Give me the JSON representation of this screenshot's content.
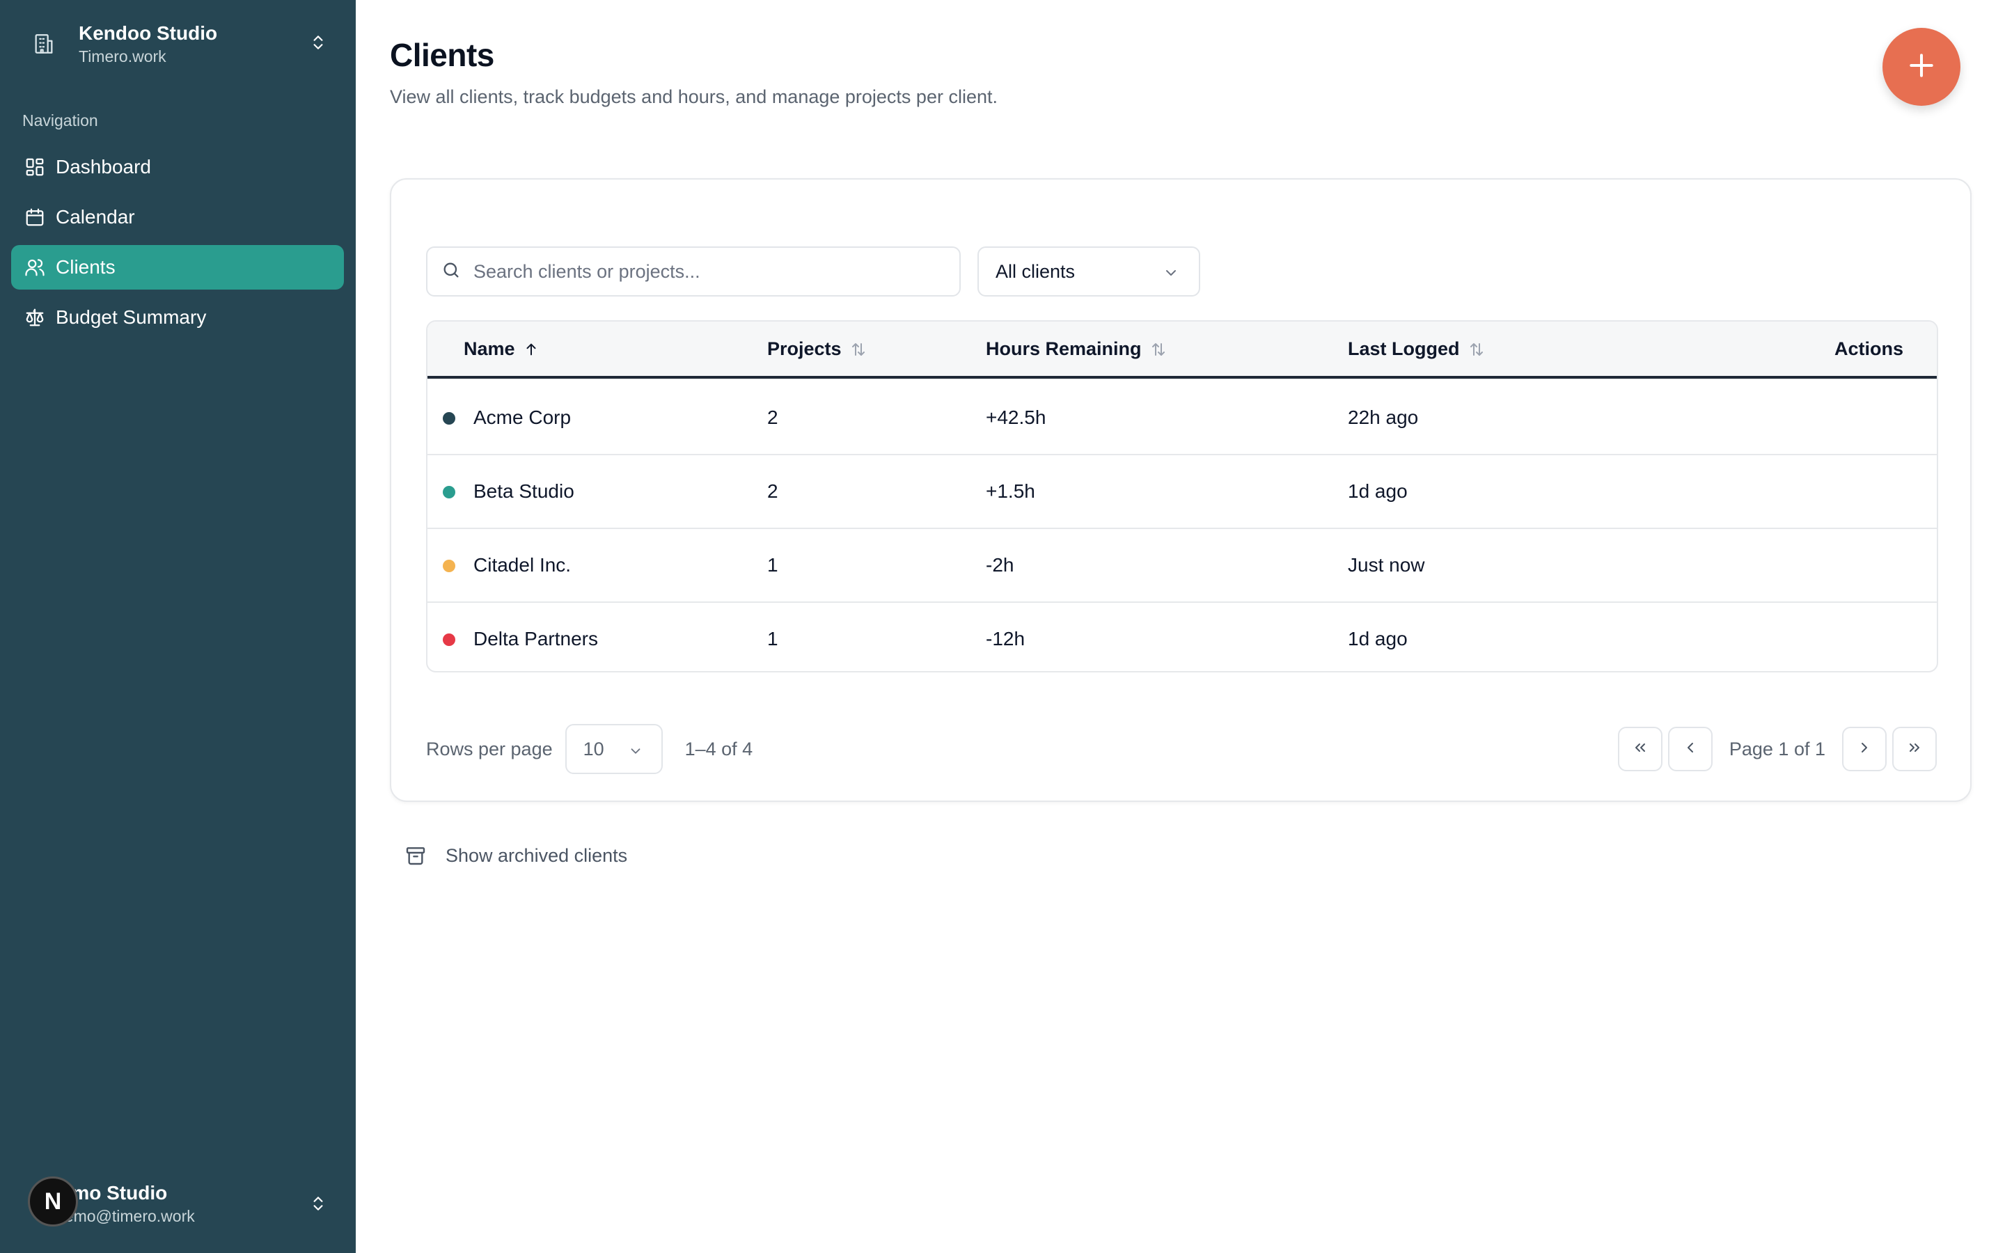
{
  "sidebar": {
    "team": {
      "name": "Kendoo Studio",
      "domain": "Timero.work",
      "icon": "building-icon"
    },
    "nav_label": "Navigation",
    "items": [
      {
        "label": "Dashboard",
        "icon": "layout-grid-icon",
        "active": false
      },
      {
        "label": "Calendar",
        "icon": "calendar-icon",
        "active": false
      },
      {
        "label": "Clients",
        "icon": "users-icon",
        "active": true
      },
      {
        "label": "Budget Summary",
        "icon": "scale-icon",
        "active": false
      }
    ],
    "user": {
      "avatar_letter": "N",
      "name": "Demo Studio",
      "name_visible": "mo Studio",
      "email": "demo@timero.work",
      "email_visible": "emo@timero.work"
    }
  },
  "header": {
    "title": "Clients",
    "description": "View all clients, track budgets and hours, and manage projects per client."
  },
  "toolbar": {
    "search_placeholder": "Search clients or projects...",
    "filter_value": "All clients"
  },
  "table": {
    "columns": [
      "Name",
      "Projects",
      "Hours Remaining",
      "Last Logged",
      "Actions"
    ],
    "rows": [
      {
        "name": "Acme Corp",
        "projects": "2",
        "hours": "+42.5h",
        "last": "22h ago",
        "color": "#264653"
      },
      {
        "name": "Beta Studio",
        "projects": "2",
        "hours": "+1.5h",
        "last": "1d ago",
        "color": "#2a9d8f"
      },
      {
        "name": "Citadel Inc.",
        "projects": "1",
        "hours": "-2h",
        "last": "Just now",
        "color": "#f4b350"
      },
      {
        "name": "Delta Partners",
        "projects": "1",
        "hours": "-12h",
        "last": "1d ago",
        "color": "#e63946"
      }
    ]
  },
  "pagination": {
    "rows_label": "Rows per page",
    "rows_value": "10",
    "range": "1–4 of 4",
    "page_info": "Page 1 of 1"
  },
  "archived": {
    "label": "Show archived clients"
  },
  "colors": {
    "sidebar": "#264653",
    "active": "#2a9d8f",
    "fab": "#e76f51"
  }
}
